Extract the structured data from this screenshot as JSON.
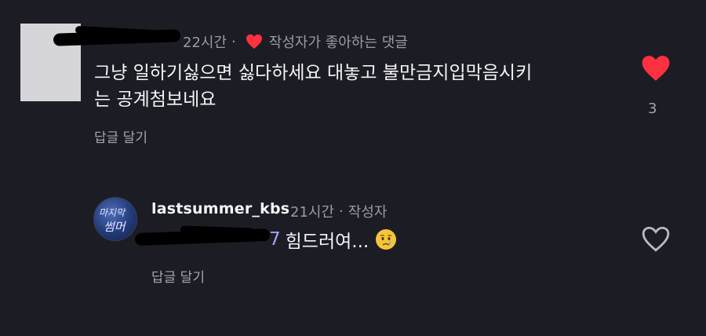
{
  "comment": {
    "time": "22시간",
    "separator": "·",
    "liked_by_author": "작성자가 좋아하는 댓글",
    "text_line1": "그냥 일하기싫으면 싫다하세요 대놓고 불만금지입막음시키",
    "text_line2": "는 공계첨보네요",
    "reply_link": "답글 달기",
    "like_count": "3",
    "like_color": "#ff3040"
  },
  "reply": {
    "avatar_text": "마지막 썸머",
    "username": "lastsummer_kbs",
    "time": "21시간",
    "separator": "·",
    "author_badge": "작성자",
    "mention_tail": "7",
    "text": "힘드러여...",
    "emoji": "crying-face",
    "reply_link": "답글 달기"
  }
}
